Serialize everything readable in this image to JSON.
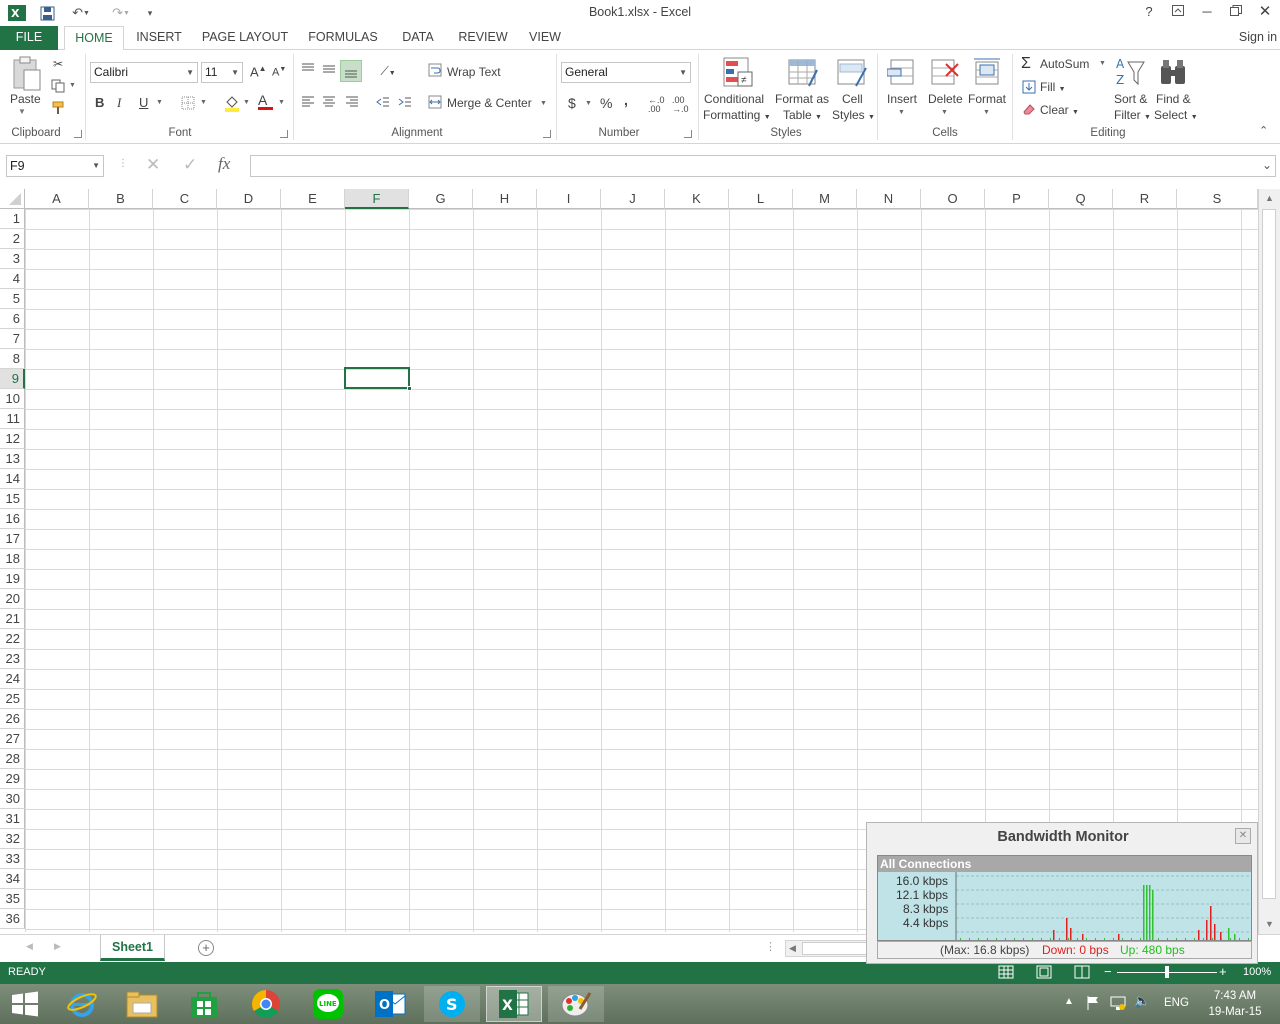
{
  "window": {
    "title": "Book1.xlsx - Excel",
    "help": "?",
    "sign_in": "Sign in"
  },
  "tabs": [
    {
      "label": "FILE"
    },
    {
      "label": "HOME"
    },
    {
      "label": "INSERT"
    },
    {
      "label": "PAGE LAYOUT"
    },
    {
      "label": "FORMULAS"
    },
    {
      "label": "DATA"
    },
    {
      "label": "REVIEW"
    },
    {
      "label": "VIEW"
    }
  ],
  "ribbon": {
    "clipboard": {
      "group": "Clipboard",
      "paste": "Paste"
    },
    "font": {
      "group": "Font",
      "name": "Calibri",
      "size": "11",
      "bold": "B",
      "italic": "I",
      "underline": "U",
      "grow": "A",
      "shrink": "A",
      "font_color": "A"
    },
    "alignment": {
      "group": "Alignment",
      "wrap": "Wrap Text",
      "merge": "Merge & Center"
    },
    "number": {
      "group": "Number",
      "format": "General",
      "currency": "$",
      "percent": "%",
      "comma": ",",
      "inc_dec": "←.0 .00",
      "dec_dec": ".00 →.0"
    },
    "styles": {
      "group": "Styles",
      "cond1": "Conditional",
      "cond2": "Formatting",
      "fmt1": "Format as",
      "fmt2": "Table",
      "cell1": "Cell",
      "cell2": "Styles"
    },
    "cells": {
      "group": "Cells",
      "insert": "Insert",
      "delete": "Delete",
      "format": "Format"
    },
    "editing": {
      "group": "Editing",
      "autosum": "AutoSum",
      "fill": "Fill",
      "clear": "Clear",
      "sort1": "Sort &",
      "sort2": "Filter",
      "find1": "Find &",
      "find2": "Select"
    }
  },
  "formula_bar": {
    "name_box": "F9",
    "fx": "fx",
    "value": ""
  },
  "grid": {
    "columns": [
      "A",
      "B",
      "C",
      "D",
      "E",
      "F",
      "G",
      "H",
      "I",
      "J",
      "K",
      "L",
      "M",
      "N",
      "O",
      "P",
      "Q",
      "R",
      "S"
    ],
    "rows": [
      "1",
      "2",
      "3",
      "4",
      "5",
      "6",
      "7",
      "8",
      "9",
      "10",
      "11",
      "12",
      "13",
      "14",
      "15",
      "16",
      "17",
      "18",
      "19",
      "20",
      "21",
      "22",
      "23",
      "24",
      "25",
      "26",
      "27",
      "28",
      "29",
      "30",
      "31",
      "32",
      "33",
      "34",
      "35",
      "36"
    ],
    "selected_col": "F",
    "selected_row": "9"
  },
  "sheets": [
    {
      "name": "Sheet1",
      "active": true
    }
  ],
  "status": {
    "mode": "READY",
    "zoom": "100%",
    "zoom_level": 0.5
  },
  "taskbar": {
    "lang": "ENG",
    "time": "7:43 AM",
    "date": "19-Mar-15"
  },
  "bandwidth_monitor": {
    "title": "Bandwidth Monitor",
    "panel": "All Connections",
    "y_labels": [
      "16.0 kbps",
      "12.1 kbps",
      "8.3 kbps",
      "4.4 kbps"
    ],
    "max": "(Max: 16.8 kbps)",
    "down": "Down: 0 bps",
    "up": "Up: 480 bps"
  },
  "colors": {
    "accent": "#217346",
    "bw_down": "#e02020",
    "bw_up": "#20c020"
  }
}
